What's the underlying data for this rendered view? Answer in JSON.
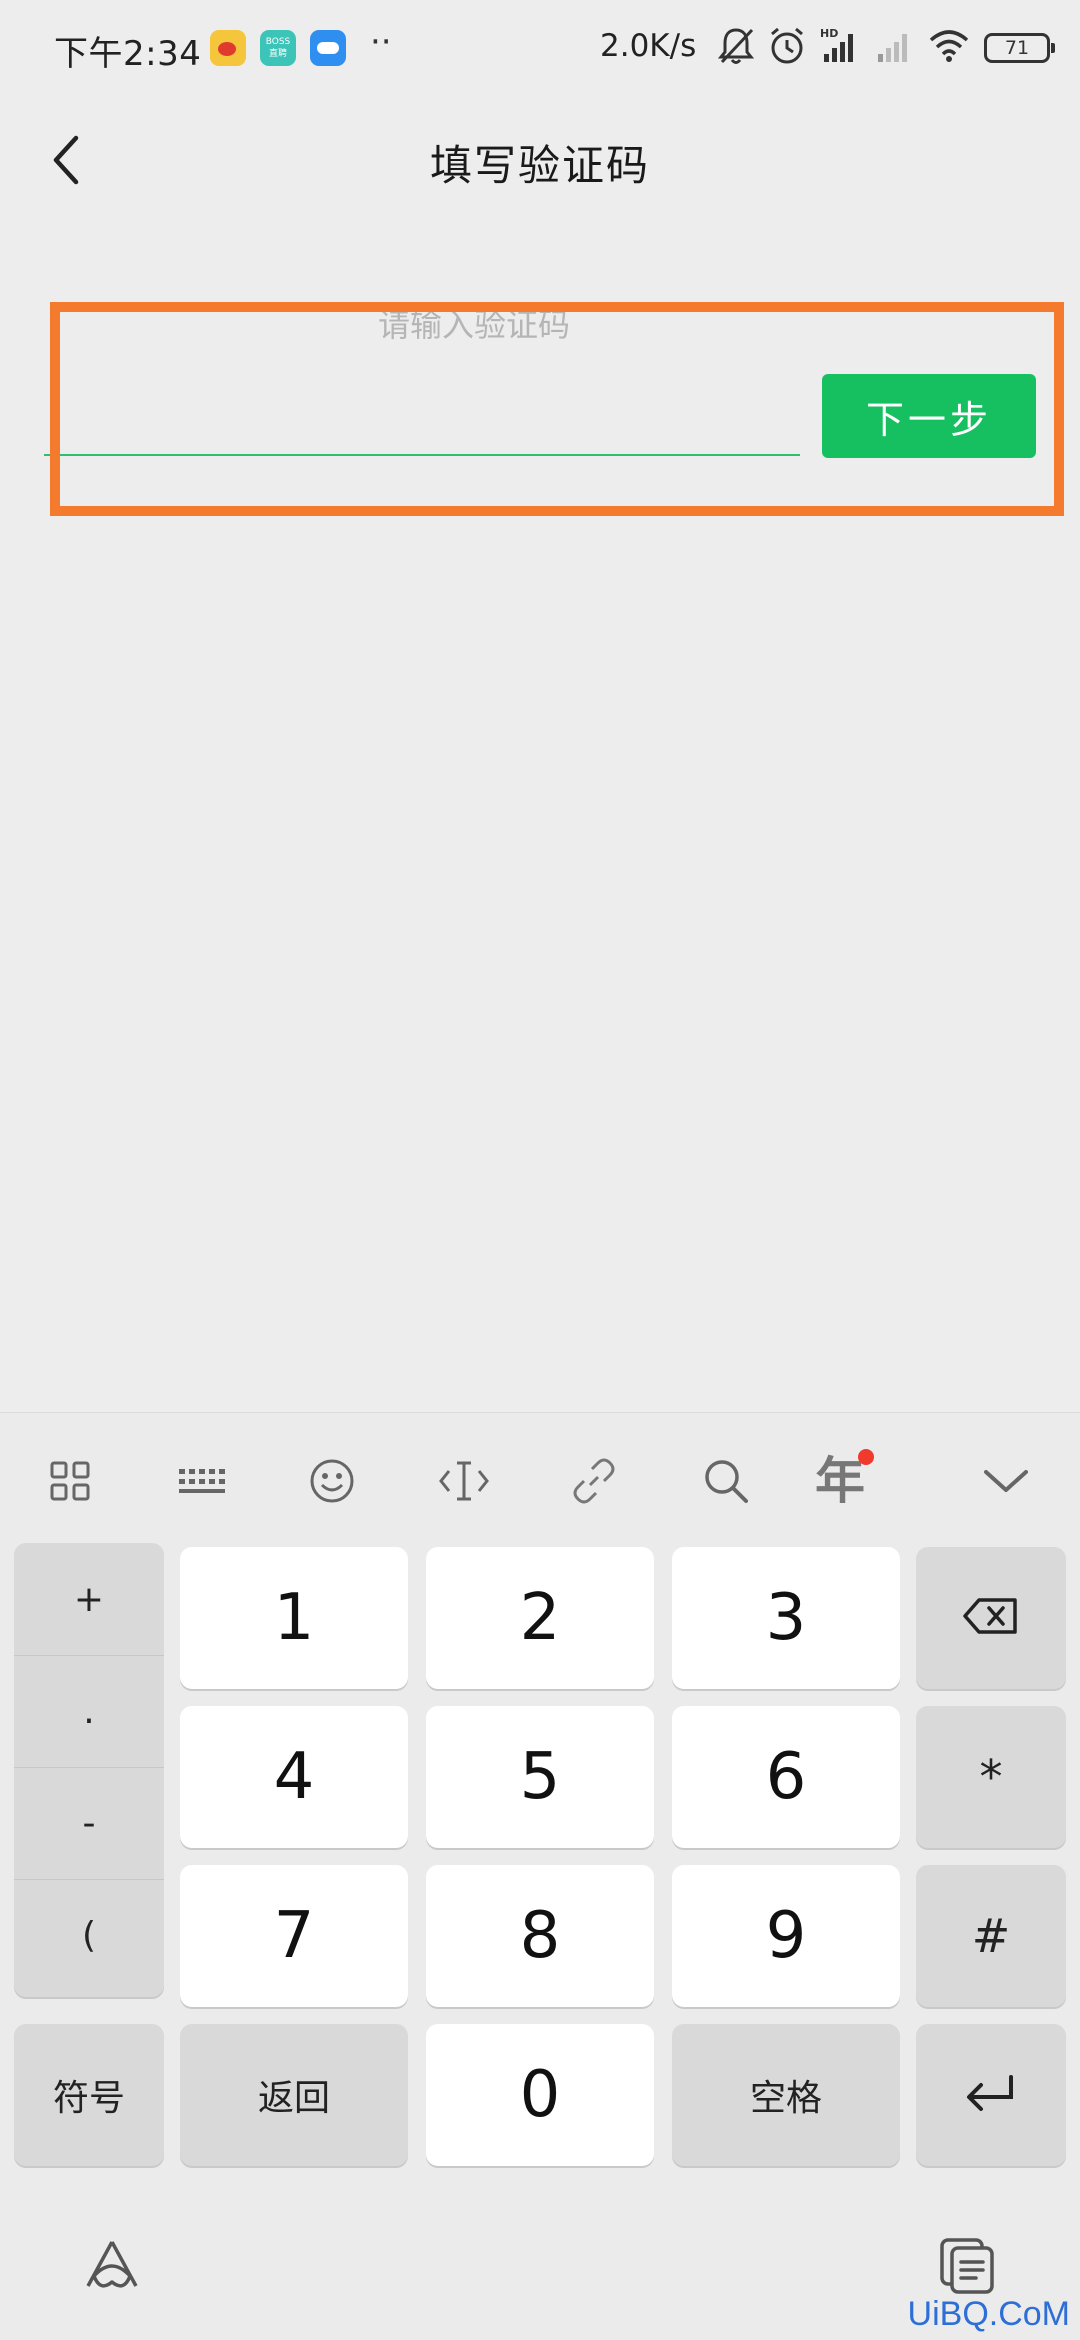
{
  "status_bar": {
    "time": "下午2:34",
    "boss_label": "BOSS\n直聘",
    "more": "··",
    "net_speed": "2.0K/s",
    "battery": "71"
  },
  "header": {
    "title": "填写验证码"
  },
  "form": {
    "hint": "请输入验证码",
    "code_value": "",
    "next_label": "下一步",
    "highlight_color": "#f47a2e",
    "accent_color": "#16c060"
  },
  "keyboard": {
    "toolbar": [
      "grid-icon",
      "keyboard-icon",
      "emoji-icon",
      "cursor-icon",
      "link-icon",
      "search-icon",
      "year-icon",
      "collapse-icon"
    ],
    "year_label": "年",
    "side_keys": [
      "+",
      ".",
      "-",
      "("
    ],
    "digits": [
      "1",
      "2",
      "3",
      "4",
      "5",
      "6",
      "7",
      "8",
      "9",
      "0"
    ],
    "star": "*",
    "hash": "#",
    "symbols_label": "符号",
    "back_label": "返回",
    "space_label": "空格"
  },
  "watermark": "UiBQ.CoM"
}
